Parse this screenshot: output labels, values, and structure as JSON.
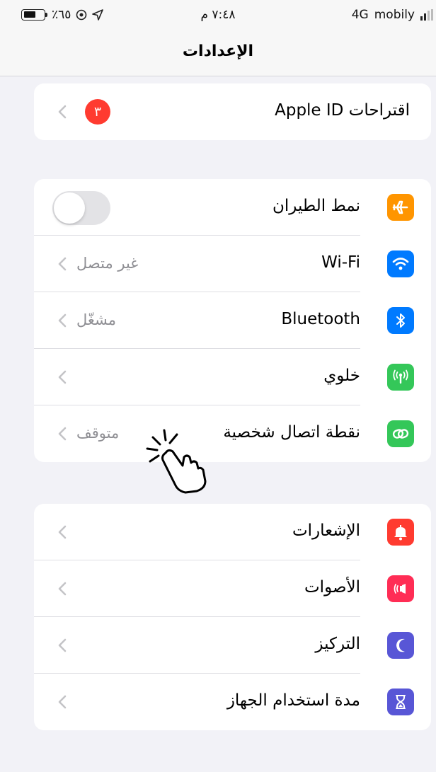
{
  "status_bar": {
    "battery": "٪٦٥",
    "time": "٧:٤٨ م",
    "network": "4G",
    "carrier": "mobily"
  },
  "nav": {
    "title": "الإعدادات"
  },
  "apple_id_group": {
    "label": "اقتراحات Apple ID",
    "badge": "٣"
  },
  "connectivity": [
    {
      "name": "airplane",
      "label": "نمط الطيران",
      "value": "",
      "icon_color": "#ff9500",
      "toggle_on": false
    },
    {
      "name": "wifi",
      "label": "Wi-Fi",
      "value": "غير متصل",
      "icon_color": "#007aff"
    },
    {
      "name": "bluetooth",
      "label": "Bluetooth",
      "value": "مشغّل",
      "icon_color": "#007aff"
    },
    {
      "name": "cellular",
      "label": "خلوي",
      "value": "",
      "icon_color": "#34c759"
    },
    {
      "name": "hotspot",
      "label": "نقطة اتصال شخصية",
      "value": "متوقف",
      "icon_color": "#34c759"
    }
  ],
  "notifications_group": [
    {
      "name": "notifications",
      "label": "الإشعارات",
      "icon_color": "#ff3b30"
    },
    {
      "name": "sounds",
      "label": "الأصوات",
      "icon_color": "#ff2d55"
    },
    {
      "name": "focus",
      "label": "التركيز",
      "icon_color": "#5856d6"
    },
    {
      "name": "screen-time",
      "label": "مدة استخدام الجهاز",
      "icon_color": "#5856d6"
    }
  ]
}
